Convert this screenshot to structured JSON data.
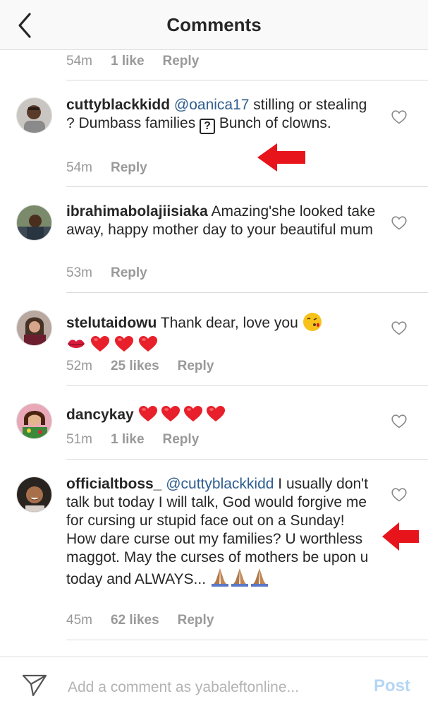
{
  "header": {
    "title": "Comments",
    "back_icon": "chevron-left-icon"
  },
  "top_meta": {
    "time": "54m",
    "likes": "1 like",
    "reply": "Reply"
  },
  "comments": [
    {
      "username": "cuttyblackkidd",
      "mention": "@oanica17",
      "text_a": " stilling or stealing ? Dumbass families ",
      "box_glyph": "?",
      "text_b": " Bunch of clowns.",
      "time": "54m",
      "likes": "",
      "reply": "Reply"
    },
    {
      "username": "ibrahimabolajiisiaka",
      "text": " Amazing'she looked take away, happy mother day to your beautiful mum",
      "time": "53m",
      "likes": "",
      "reply": "Reply"
    },
    {
      "username": "stelutaidowu",
      "text": " Thank dear, love you ",
      "time": "52m",
      "likes": "25 likes",
      "reply": "Reply"
    },
    {
      "username": "dancykay",
      "text": " ",
      "time": "51m",
      "likes": "1 like",
      "reply": "Reply"
    },
    {
      "username": "officialtboss_",
      "mention": "@cuttyblackkidd",
      "text": " I usually don't talk but today I will talk, God would forgive me for cursing ur stupid face out on a Sunday! How dare curse out my families? U worthless maggot. May the curses of mothers be upon u today and ALWAYS... ",
      "time": "45m",
      "likes": "62 likes",
      "reply": "Reply"
    }
  ],
  "footer": {
    "placeholder": "Add a comment as yabaleftonline...",
    "post_label": "Post",
    "send_icon": "paper-plane-icon"
  },
  "colors": {
    "meta_gray": "#999999",
    "mention_blue": "#2f5e8f",
    "post_disabled": "#b5d6f5",
    "annotation_red": "#e8141c"
  }
}
